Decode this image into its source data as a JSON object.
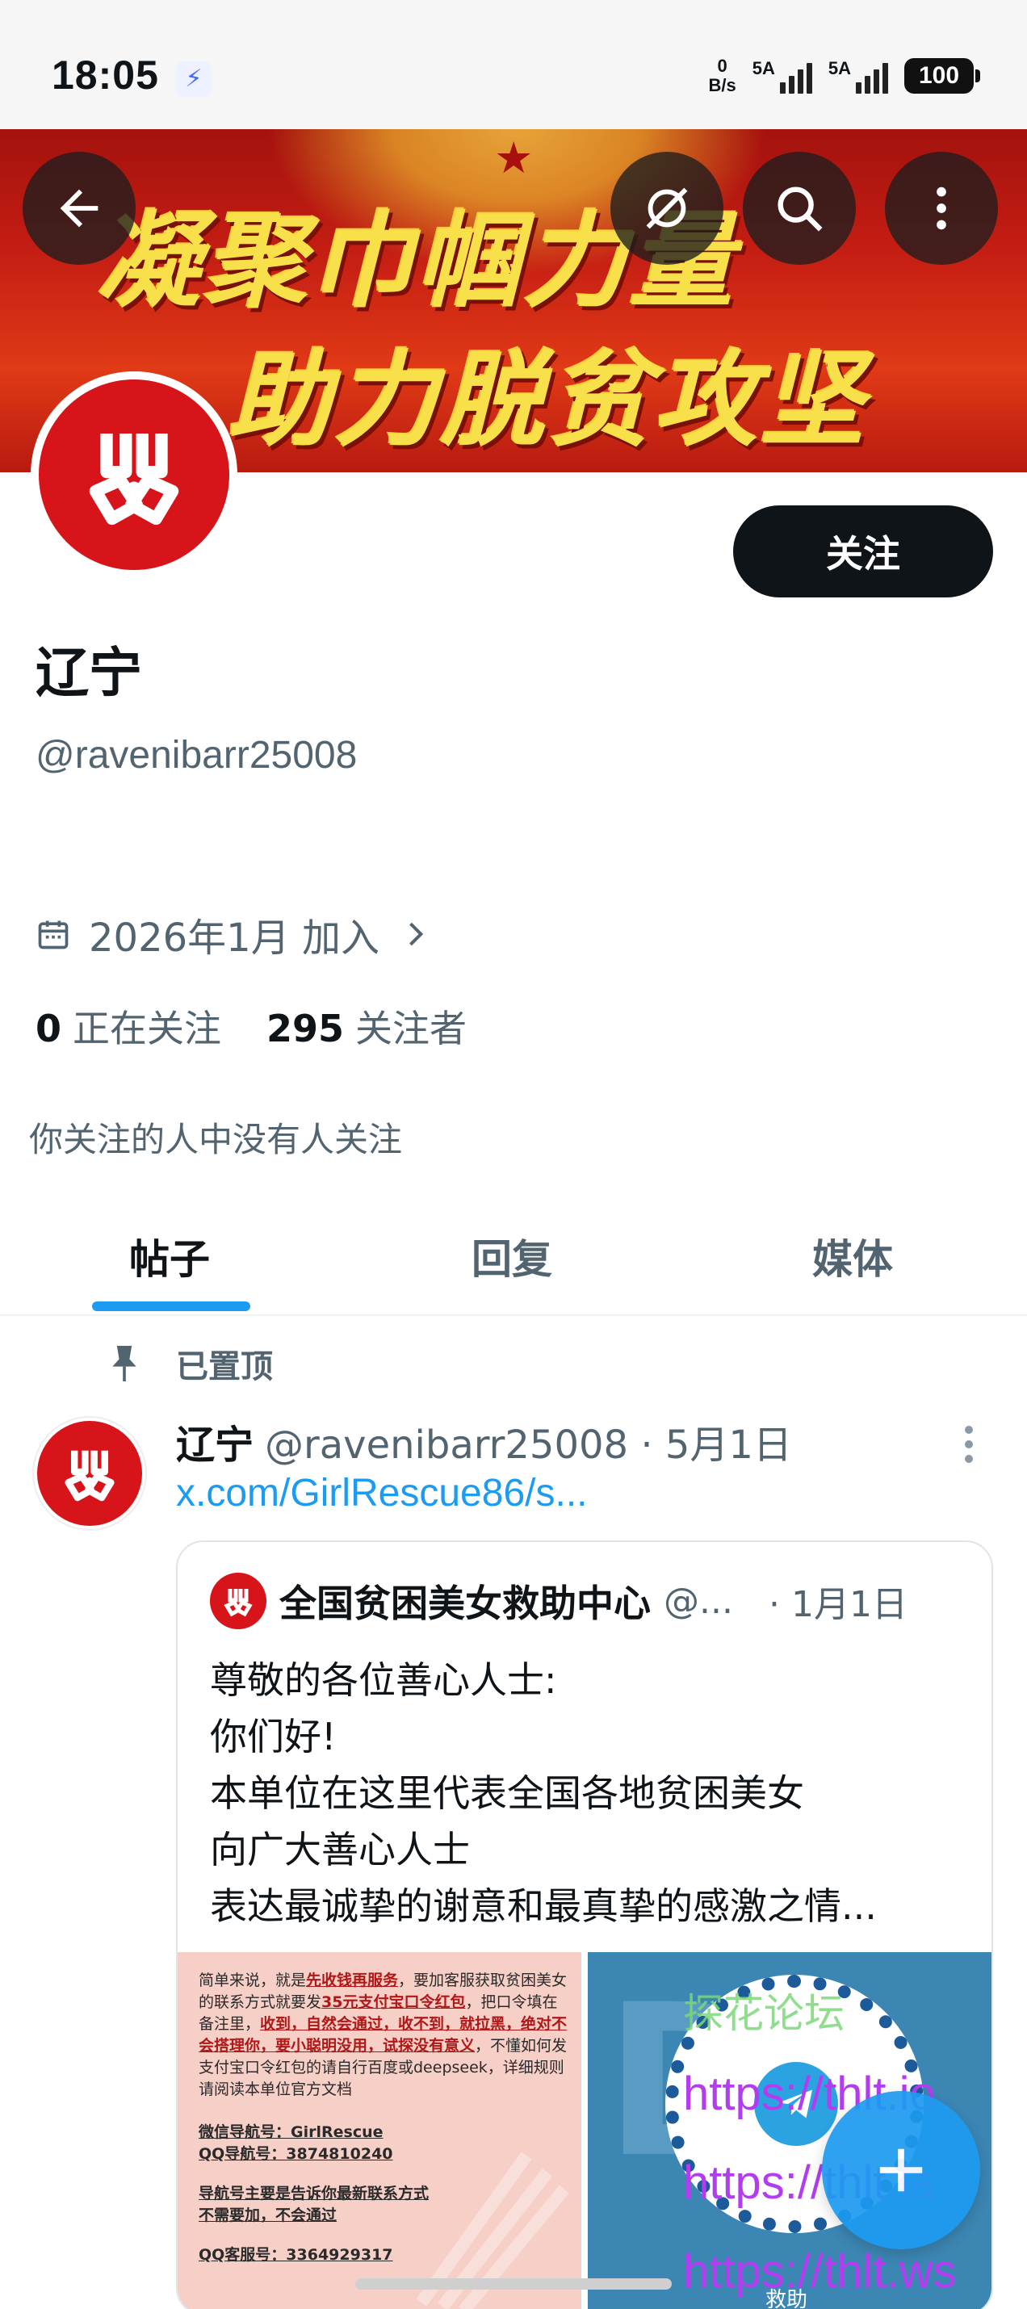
{
  "status_bar": {
    "time": "18:05",
    "net_speed_top": "0",
    "net_speed_bottom": "B/s",
    "sim1_label": "5A",
    "sim2_label": "5A",
    "battery": "100"
  },
  "banner": {
    "line1": "凝聚巾帼力量",
    "line2": "助力脱贫攻坚"
  },
  "header_icons": {
    "back": "back-arrow-icon",
    "grok": "grok-icon",
    "search": "search-icon",
    "more": "more-vertical-icon"
  },
  "profile": {
    "name": "辽宁",
    "handle": "@ravenibarr25008",
    "follow_label": "关注",
    "joined": "2026年1月 加入",
    "following_count": "0",
    "following_label": "正在关注",
    "followers_count": "295",
    "followers_label": "关注者",
    "no_mutual": "你关注的人中没有人关注"
  },
  "tabs": [
    {
      "label": "帖子",
      "active": true
    },
    {
      "label": "回复",
      "active": false
    },
    {
      "label": "媒体",
      "active": false
    }
  ],
  "post": {
    "pinned_label": "已置顶",
    "author_name": "辽宁",
    "author_meta": "@ravenibarr25008 · 5月1日",
    "link": "x.com/GirlRescue86/s...",
    "quote": {
      "name": "全国贫困美女救助中心",
      "handle": "@...",
      "date": "· 1月1日",
      "lines": [
        "尊敬的各位善心人士:",
        "你们好!",
        "本单位在这里代表全国各地贫困美女",
        "向广大善心人士",
        "表达最诚挚的谢意和最真挚的感激之情..."
      ],
      "image1_text": {
        "p1a": "简单来说，就是",
        "p1b": "先收钱再服务",
        "p1c": "，要加客服获取贫困美女的联系方式就要发",
        "p1d": "35元支付宝口令红包",
        "p1e": "，把口令填在备注里，",
        "p1f": "收到，自然会通过，收不到，就拉黑，绝对不会搭理你，要小聪明没用，试探没有意义",
        "p1g": "，不懂如何发支付宝口令红包的请自行百度或deepseek，详细规则请阅读本单位官方文档",
        "wechat": "微信导航号：GirlRescue",
        "qq": "QQ导航号：3874810240",
        "nav_note1": "导航号主要是告诉你最新联系方式",
        "nav_note2": "不需要加，不会通过",
        "service": "QQ客服号：3364929317"
      },
      "image2_caption": "救助"
    }
  },
  "watermarks": [
    "探花论坛",
    "https://thlt.io",
    "https://thlt.la",
    "https://thlt.ws"
  ],
  "colors": {
    "accent": "#1d9bf0",
    "text_primary": "#0f1419",
    "text_secondary": "#536471",
    "logo_red": "#d7141a"
  }
}
